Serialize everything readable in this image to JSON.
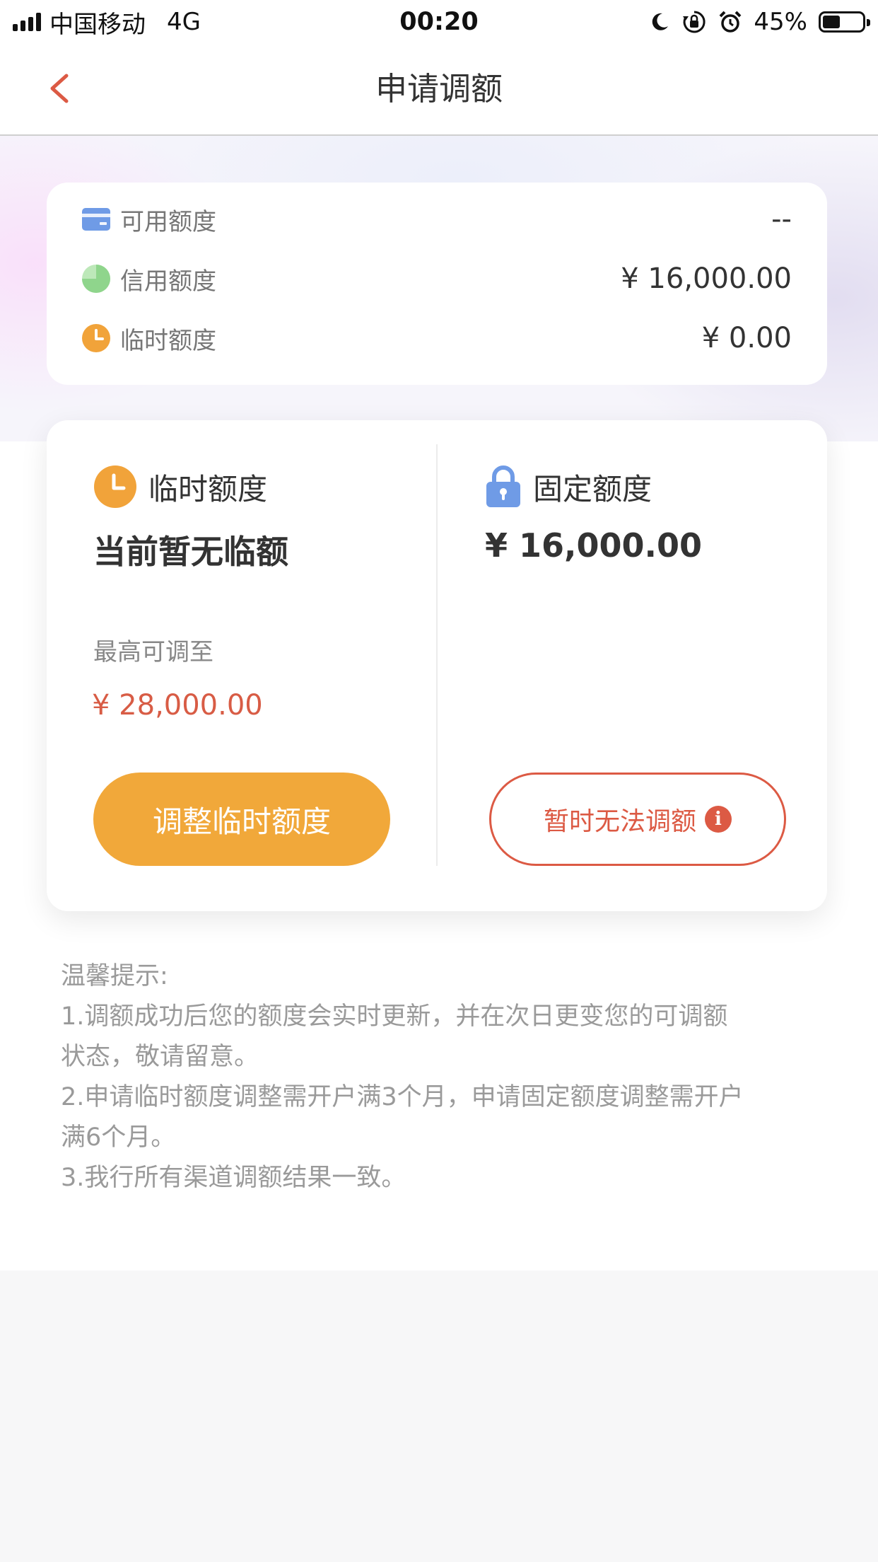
{
  "status_bar": {
    "carrier": "中国移动",
    "network": "4G",
    "time": "00:20",
    "battery_percent": "45%",
    "battery_level": 0.45,
    "icons": [
      "signal-icon",
      "moon-icon",
      "rotation-lock-icon",
      "alarm-icon",
      "battery-icon"
    ]
  },
  "nav": {
    "title": "申请调额",
    "back_icon": "chevron-left-icon"
  },
  "summary": {
    "items": [
      {
        "label": "可用额度",
        "value": "--",
        "icon": "card-icon",
        "color": "#6f9be6"
      },
      {
        "label": "信用额度",
        "value": "¥ 16,000.00",
        "icon": "pie-icon",
        "color": "#8fd58c"
      },
      {
        "label": "临时额度",
        "value": "¥ 0.00",
        "icon": "clock-icon",
        "color": "#f1a33a"
      }
    ]
  },
  "temporary": {
    "title": "临时额度",
    "status": "当前暂无临额",
    "max_label": "最高可调至",
    "max_value": "¥ 28,000.00",
    "button": "调整临时额度"
  },
  "fixed": {
    "title": "固定额度",
    "amount": "¥ 16,000.00",
    "button": "暂时无法调额",
    "info_glyph": "i"
  },
  "tips": {
    "title": "温馨提示:",
    "lines": [
      "1.调额成功后您的额度会实时更新，并在次日更变您的可调额",
      "状态，敬请留意。",
      "2.申请临时额度调整需开户满3个月，申请固定额度调整需开户",
      "满6个月。",
      "3.我行所有渠道调额结果一致。"
    ]
  },
  "colors": {
    "accent_orange": "#f1a83a",
    "accent_red": "#dc5a44",
    "lock_blue": "#6f9be6"
  }
}
